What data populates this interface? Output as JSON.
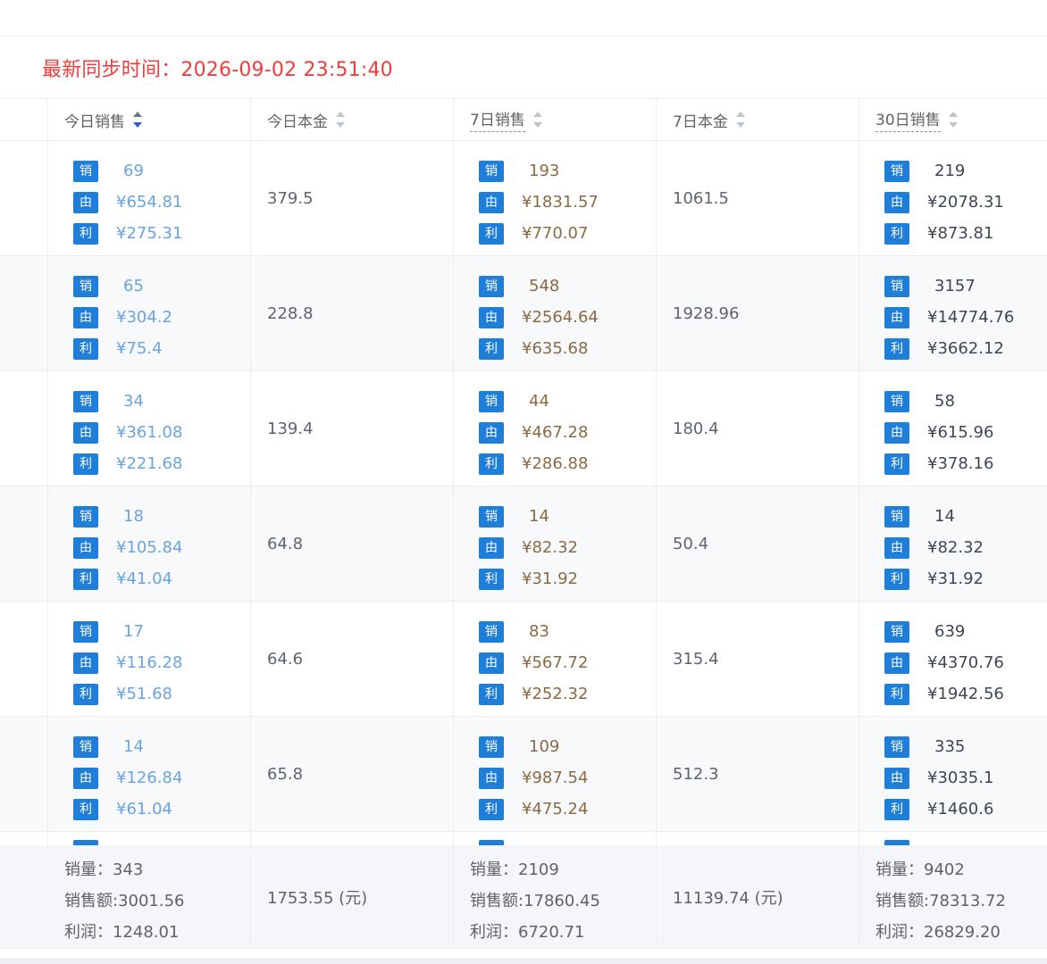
{
  "sync": {
    "label": "最新同步时间：",
    "time": "2026-09-02 23:51:40"
  },
  "badges": {
    "sales": "销",
    "revenue": "由",
    "profit": "利"
  },
  "colors": {
    "badge_bg": "#1e7ed8",
    "sync_red": "#f23c3c",
    "today_blue": "#6aa3e0",
    "period_brown": "#8a6a43"
  },
  "columns": [
    {
      "label": "今日销售",
      "sort": "desc"
    },
    {
      "label": "今日本金",
      "sort": "none"
    },
    {
      "label": "7日销售",
      "sort": "none"
    },
    {
      "label": "7日本金",
      "sort": "none"
    },
    {
      "label": "30日销售",
      "sort": "none"
    }
  ],
  "rows": [
    {
      "today": {
        "qty": "69",
        "revenue": "¥654.81",
        "profit": "¥275.31"
      },
      "today_cost": "379.5",
      "d7": {
        "qty": "193",
        "revenue": "¥1831.57",
        "profit": "¥770.07"
      },
      "d7_cost": "1061.5",
      "d30": {
        "qty": "219",
        "revenue": "¥2078.31",
        "profit": "¥873.81"
      }
    },
    {
      "today": {
        "qty": "65",
        "revenue": "¥304.2",
        "profit": "¥75.4"
      },
      "today_cost": "228.8",
      "d7": {
        "qty": "548",
        "revenue": "¥2564.64",
        "profit": "¥635.68"
      },
      "d7_cost": "1928.96",
      "d30": {
        "qty": "3157",
        "revenue": "¥14774.76",
        "profit": "¥3662.12"
      }
    },
    {
      "today": {
        "qty": "34",
        "revenue": "¥361.08",
        "profit": "¥221.68"
      },
      "today_cost": "139.4",
      "d7": {
        "qty": "44",
        "revenue": "¥467.28",
        "profit": "¥286.88"
      },
      "d7_cost": "180.4",
      "d30": {
        "qty": "58",
        "revenue": "¥615.96",
        "profit": "¥378.16"
      }
    },
    {
      "today": {
        "qty": "18",
        "revenue": "¥105.84",
        "profit": "¥41.04"
      },
      "today_cost": "64.8",
      "d7": {
        "qty": "14",
        "revenue": "¥82.32",
        "profit": "¥31.92"
      },
      "d7_cost": "50.4",
      "d30": {
        "qty": "14",
        "revenue": "¥82.32",
        "profit": "¥31.92"
      }
    },
    {
      "today": {
        "qty": "17",
        "revenue": "¥116.28",
        "profit": "¥51.68"
      },
      "today_cost": "64.6",
      "d7": {
        "qty": "83",
        "revenue": "¥567.72",
        "profit": "¥252.32"
      },
      "d7_cost": "315.4",
      "d30": {
        "qty": "639",
        "revenue": "¥4370.76",
        "profit": "¥1942.56"
      }
    },
    {
      "today": {
        "qty": "14",
        "revenue": "¥126.84",
        "profit": "¥61.04"
      },
      "today_cost": "65.8",
      "d7": {
        "qty": "109",
        "revenue": "¥987.54",
        "profit": "¥475.24"
      },
      "d7_cost": "512.3",
      "d30": {
        "qty": "335",
        "revenue": "¥3035.1",
        "profit": "¥1460.6"
      }
    }
  ],
  "summary": {
    "today": {
      "qty": "销量：343",
      "revenue": "销售额:3001.56",
      "profit": "利润：1248.01"
    },
    "today_cost": "1753.55 (元)",
    "d7": {
      "qty": "销量：2109",
      "revenue": "销售额:17860.45",
      "profit": "利润：6720.71"
    },
    "d7_cost": "11139.74 (元)",
    "d30": {
      "qty": "销量：9402",
      "revenue": "销售额:78313.72",
      "profit": "利润：26829.20"
    }
  }
}
